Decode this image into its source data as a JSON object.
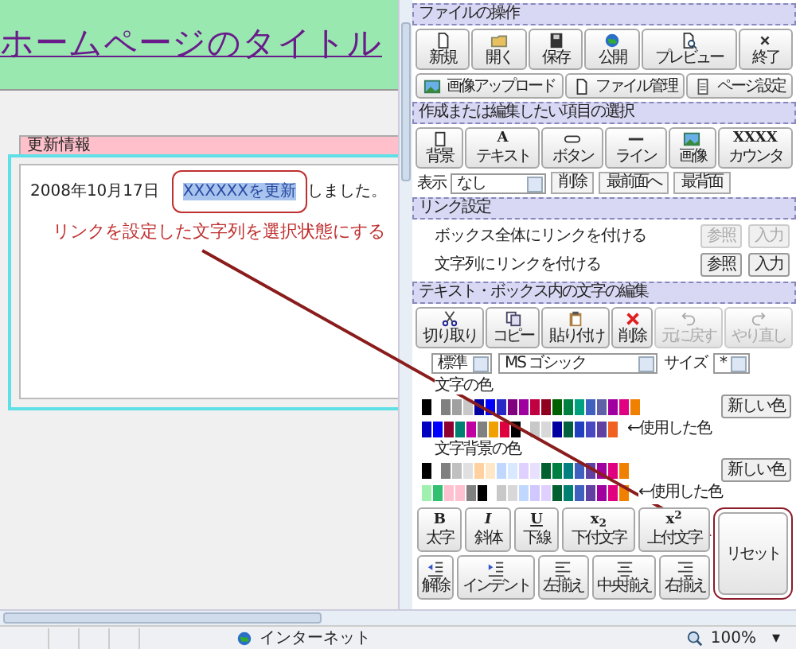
{
  "page": {
    "title": "ホームページのタイトル",
    "section_heading": "更新情報",
    "date": "2008年10月17日",
    "news": [
      {
        "text": "XXXXXXを更新",
        "selected": true
      },
      {
        "text": "しました。",
        "selected": false
      }
    ],
    "annotation": "リンクを設定した文字列を選択状態にする"
  },
  "panel": {
    "file_ops": {
      "heading": "ファイルの操作",
      "buttons": [
        {
          "label": "新規"
        },
        {
          "label": "開く"
        },
        {
          "label": "保存"
        },
        {
          "label": "公開"
        },
        {
          "label": "プレビュー"
        },
        {
          "label": "終了"
        }
      ],
      "links": [
        {
          "label": "画像アップロード"
        },
        {
          "label": "ファイル管理"
        },
        {
          "label": "ページ設定"
        }
      ]
    },
    "item_select": {
      "heading": "作成または編集したい項目の選択",
      "buttons": [
        {
          "label": "背景"
        },
        {
          "label": "テキスト",
          "glyph": "A"
        },
        {
          "label": "ボタン"
        },
        {
          "label": "ライン"
        },
        {
          "label": "画像"
        },
        {
          "label": "カウンタ",
          "glyph": "XXXX"
        }
      ],
      "order_row": {
        "label": "表示",
        "select": "なし",
        "buttons": [
          "削除",
          "最前面へ",
          "最背面"
        ]
      }
    },
    "link": {
      "heading": "リンク設定",
      "rows": [
        {
          "label": "ボックス全体にリンクを付ける",
          "buttons": [
            {
              "label": "参照",
              "disabled": true
            },
            {
              "label": "入力",
              "disabled": true
            }
          ]
        },
        {
          "label": "文字列にリンクを付ける",
          "buttons": [
            {
              "label": "参照",
              "disabled": false
            },
            {
              "label": "入力",
              "disabled": false
            }
          ]
        }
      ]
    },
    "text_edit": {
      "heading": "テキスト・ボックス内の文字の編集",
      "buttons": [
        {
          "label": "切り取り",
          "disabled": false
        },
        {
          "label": "コピー",
          "disabled": false
        },
        {
          "label": "貼り付け",
          "disabled": false
        },
        {
          "label": "削除",
          "disabled": false
        },
        {
          "label": "元に戻す",
          "disabled": true
        },
        {
          "label": "やり直し",
          "disabled": true
        }
      ],
      "style_select": "標準",
      "font_select": "MS ゴシック",
      "size_label": "サイズ",
      "size_select": "*",
      "palettes": [
        {
          "label": "文字の色",
          "rows": [
            {
              "groups": [
                [
                  {
                    "color": "#000000"
                  }
                ],
                [
                  {
                    "color": "#808080"
                  },
                  {
                    "color": "#a0a0a0"
                  },
                  {
                    "color": "#c8c8c8"
                  },
                  {
                    "color": "#0000a0"
                  },
                  {
                    "color": "#0000ff"
                  },
                  {
                    "color": "#2828c8"
                  },
                  {
                    "color": "#800080"
                  },
                  {
                    "color": "#a000a0"
                  },
                  {
                    "color": "#c00040"
                  },
                  {
                    "color": "#900020"
                  },
                  {
                    "color": "#006000"
                  },
                  {
                    "color": "#008040"
                  },
                  {
                    "color": "#00a080"
                  },
                  {
                    "color": "#4060c0"
                  },
                  {
                    "color": "#6060a8"
                  },
                  {
                    "color": "#a000a0"
                  },
                  {
                    "color": "#e00080"
                  },
                  {
                    "color": "#f08000"
                  }
                ]
              ],
              "button": "新しい色"
            },
            {
              "groups": [
                [
                  {
                    "color": "#0000c0"
                  },
                  {
                    "color": "#0000ff"
                  },
                  {
                    "color": "#900030"
                  },
                  {
                    "color": "#008070"
                  },
                  {
                    "color": "#c000a0"
                  },
                  {
                    "color": "#808080"
                  },
                  {
                    "color": "#f0a000"
                  },
                  {
                    "color": "#e00040"
                  },
                  {
                    "color": "#000000"
                  }
                ],
                [
                  {
                    "color": "#c8c8c8"
                  },
                  {
                    "color": "#d8d8d8"
                  },
                  {
                    "color": "#0000a0"
                  },
                  {
                    "color": "#006040"
                  },
                  {
                    "color": "#2040c0"
                  },
                  {
                    "color": "#4848c0"
                  },
                  {
                    "color": "#6040a0"
                  },
                  {
                    "color": "#f06020"
                  }
                ]
              ],
              "note": "←使用した色"
            }
          ]
        },
        {
          "label": "文字背景の色",
          "rows": [
            {
              "groups": [
                [
                  {
                    "color": "#000000"
                  }
                ],
                [
                  {
                    "color": "#808080"
                  },
                  {
                    "color": "#c0c0c0"
                  },
                  {
                    "color": "#e0e0e0"
                  },
                  {
                    "color": "#ffd0a0"
                  },
                  {
                    "color": "#ffe8c8"
                  },
                  {
                    "color": "#c0d8ff"
                  },
                  {
                    "color": "#d8e8ff"
                  },
                  {
                    "color": "#e0d0ff"
                  },
                  {
                    "color": "#e8e0ff"
                  },
                  {
                    "color": "#006030"
                  },
                  {
                    "color": "#008040"
                  },
                  {
                    "color": "#008080"
                  },
                  {
                    "color": "#4060c0"
                  },
                  {
                    "color": "#6040a0"
                  },
                  {
                    "color": "#a000a0"
                  },
                  {
                    "color": "#e00080"
                  },
                  {
                    "color": "#f08000"
                  }
                ]
              ],
              "button": "新しい色"
            },
            {
              "groups": [
                [
                  {
                    "color": "#a0f0b0"
                  },
                  {
                    "color": "#30c070"
                  },
                  {
                    "color": "#ffc0d0"
                  },
                  {
                    "color": "#ffc0d0"
                  },
                  {
                    "color": "#808080"
                  },
                  {
                    "color": "#000000"
                  }
                ],
                [
                  {
                    "color": "#c8c8c8"
                  },
                  {
                    "color": "#d8d8d8"
                  },
                  {
                    "color": "#c0d8ff"
                  },
                  {
                    "color": "#d0c8ff"
                  },
                  {
                    "color": "#e0d0ff"
                  },
                  {
                    "color": "#006030"
                  },
                  {
                    "color": "#008070"
                  },
                  {
                    "color": "#4060c0"
                  },
                  {
                    "color": "#6040a0"
                  },
                  {
                    "color": "#a000a0"
                  },
                  {
                    "color": "#e00080"
                  },
                  {
                    "color": "#f08000"
                  }
                ]
              ],
              "note": "←使用した色"
            }
          ]
        }
      ],
      "format_rows": [
        [
          {
            "label": "太字",
            "glyph": "B"
          },
          {
            "label": "斜体",
            "glyph": "I"
          },
          {
            "label": "下線",
            "glyph": "U"
          },
          {
            "label": "下付文字",
            "glyph": "x$_{2}$"
          },
          {
            "label": "上付文字",
            "glyph": "x$^{2}$"
          }
        ],
        [
          {
            "label": "解除"
          },
          {
            "label": "インデント"
          },
          {
            "label": "左揃え"
          },
          {
            "label": "中央揃え"
          },
          {
            "label": "右揃え"
          }
        ]
      ],
      "reset": "リセット"
    }
  },
  "status_bar": {
    "zone": "インターネット",
    "zoom": "100%",
    "zoom_menu": "▾"
  }
}
